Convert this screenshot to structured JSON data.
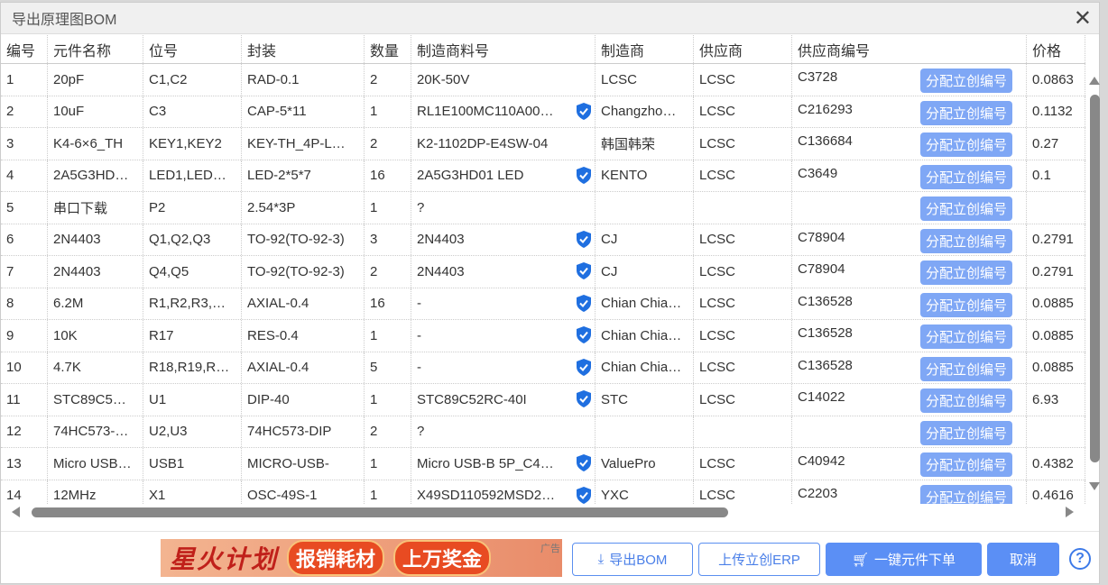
{
  "dialog": {
    "title": "导出原理图BOM",
    "close_icon": "close-icon"
  },
  "columns": [
    "编号",
    "元件名称",
    "位号",
    "封装",
    "数量",
    "制造商料号",
    "制造商",
    "供应商",
    "供应商编号",
    "价格"
  ],
  "assign_label": "分配立创编号",
  "rows": [
    {
      "no": "1",
      "name": "20pF",
      "designator": "C1,C2",
      "footprint": "RAD-0.1",
      "qty": "2",
      "mpn": "20K-50V",
      "verified": false,
      "manufacturer": "LCSC",
      "supplier": "LCSC",
      "supplier_no": "C3728",
      "price": "0.0863"
    },
    {
      "no": "2",
      "name": "10uF",
      "designator": "C3",
      "footprint": "CAP-5*11",
      "qty": "1",
      "mpn": "RL1E100MC110A00…",
      "verified": true,
      "manufacturer": "Changzho…",
      "supplier": "LCSC",
      "supplier_no": "C216293",
      "price": "0.1132"
    },
    {
      "no": "3",
      "name": "K4-6×6_TH",
      "designator": "KEY1,KEY2",
      "footprint": "KEY-TH_4P-L…",
      "qty": "2",
      "mpn": "K2-1102DP-E4SW-04",
      "verified": false,
      "manufacturer": "韩国韩荣",
      "supplier": "LCSC",
      "supplier_no": "C136684",
      "price": "0.27"
    },
    {
      "no": "4",
      "name": "2A5G3HD…",
      "designator": "LED1,LED…",
      "footprint": "LED-2*5*7",
      "qty": "16",
      "mpn": "2A5G3HD01 LED",
      "verified": true,
      "manufacturer": "KENTO",
      "supplier": "LCSC",
      "supplier_no": "C3649",
      "price": "0.1"
    },
    {
      "no": "5",
      "name": "串口下载",
      "designator": "P2",
      "footprint": "2.54*3P",
      "qty": "1",
      "mpn": "?",
      "verified": false,
      "manufacturer": "",
      "supplier": "",
      "supplier_no": "",
      "price": ""
    },
    {
      "no": "6",
      "name": "2N4403",
      "designator": "Q1,Q2,Q3",
      "footprint": "TO-92(TO-92-3)",
      "qty": "3",
      "mpn": "2N4403",
      "verified": true,
      "manufacturer": "CJ",
      "supplier": "LCSC",
      "supplier_no": "C78904",
      "price": "0.2791"
    },
    {
      "no": "7",
      "name": "2N4403",
      "designator": "Q4,Q5",
      "footprint": "TO-92(TO-92-3)",
      "qty": "2",
      "mpn": "2N4403",
      "verified": true,
      "manufacturer": "CJ",
      "supplier": "LCSC",
      "supplier_no": "C78904",
      "price": "0.2791"
    },
    {
      "no": "8",
      "name": "6.2M",
      "designator": "R1,R2,R3,…",
      "footprint": "AXIAL-0.4",
      "qty": "16",
      "mpn": "-",
      "verified": true,
      "manufacturer": "Chian Chia…",
      "supplier": "LCSC",
      "supplier_no": "C136528",
      "price": "0.0885"
    },
    {
      "no": "9",
      "name": "10K",
      "designator": "R17",
      "footprint": "RES-0.4",
      "qty": "1",
      "mpn": "-",
      "verified": true,
      "manufacturer": "Chian Chia…",
      "supplier": "LCSC",
      "supplier_no": "C136528",
      "price": "0.0885"
    },
    {
      "no": "10",
      "name": "4.7K",
      "designator": "R18,R19,R…",
      "footprint": "AXIAL-0.4",
      "qty": "5",
      "mpn": "-",
      "verified": true,
      "manufacturer": "Chian Chia…",
      "supplier": "LCSC",
      "supplier_no": "C136528",
      "price": "0.0885"
    },
    {
      "no": "11",
      "name": "STC89C5…",
      "designator": "U1",
      "footprint": "DIP-40",
      "qty": "1",
      "mpn": "STC89C52RC-40I",
      "verified": true,
      "manufacturer": "STC",
      "supplier": "LCSC",
      "supplier_no": "C14022",
      "price": "6.93"
    },
    {
      "no": "12",
      "name": "74HC573-…",
      "designator": "U2,U3",
      "footprint": "74HC573-DIP",
      "qty": "2",
      "mpn": "?",
      "verified": false,
      "manufacturer": "",
      "supplier": "",
      "supplier_no": "",
      "price": ""
    },
    {
      "no": "13",
      "name": "Micro USB…",
      "designator": "USB1",
      "footprint": "MICRO-USB-",
      "qty": "1",
      "mpn": "Micro USB-B 5P_C4…",
      "verified": true,
      "manufacturer": "ValuePro",
      "supplier": "LCSC",
      "supplier_no": "C40942",
      "price": "0.4382"
    },
    {
      "no": "14",
      "name": "12MHz",
      "designator": "X1",
      "footprint": "OSC-49S-1",
      "qty": "1",
      "mpn": "X49SD110592MSD2…",
      "verified": true,
      "manufacturer": "YXC",
      "supplier": "LCSC",
      "supplier_no": "C2203",
      "price": "0.4616"
    }
  ],
  "ad": {
    "text1": "星火计划",
    "text2": "报销耗材",
    "text3": "上万奖金",
    "tag": "广告"
  },
  "footer": {
    "export_bom": "导出BOM",
    "upload_erp": "上传立创ERP",
    "order": "一键元件下单",
    "cancel": "取消",
    "help": "?"
  },
  "colors": {
    "accent": "#5b8ff5",
    "assign": "#7fa7f5",
    "shield": "#1f6fe0"
  }
}
